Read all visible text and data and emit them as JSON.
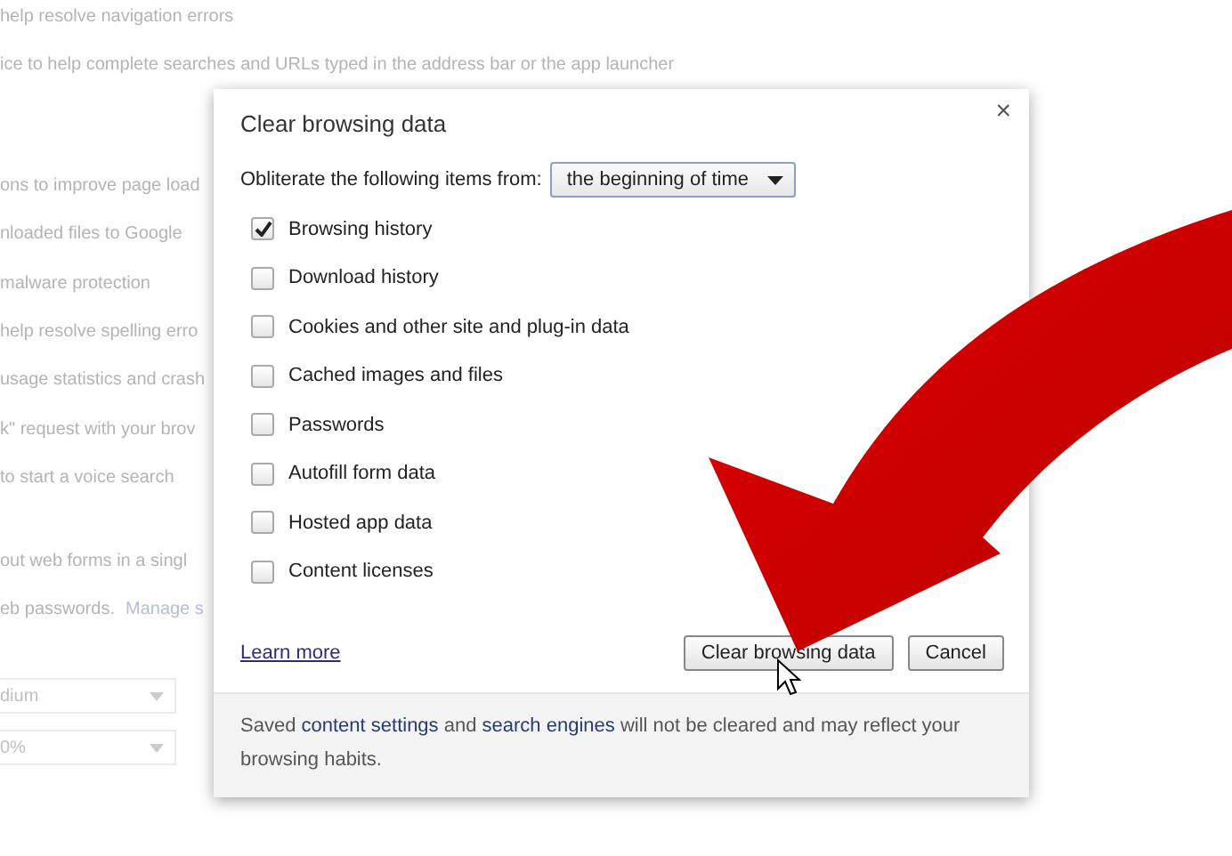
{
  "background": {
    "lines": [
      {
        "text": "help resolve navigation errors"
      },
      {
        "text": "ice to help complete searches and URLs typed in the address bar or the app launcher"
      },
      {
        "text": "ons to improve page load"
      },
      {
        "text": "nloaded files to Google"
      },
      {
        "text": "malware protection"
      },
      {
        "text": "help resolve spelling erro"
      },
      {
        "text": "usage statistics and crash"
      },
      {
        "text": "k\" request with your brov"
      },
      {
        "text": "to start a voice search"
      },
      {
        "text": "out web forms in a singl"
      },
      {
        "text": "eb passwords.",
        "link": "Manage s"
      }
    ],
    "selects": [
      "dium",
      "0%"
    ]
  },
  "dialog": {
    "title": "Clear browsing data",
    "close": "×",
    "from_label": "Obliterate the following items from:",
    "from_value": "the beginning of time",
    "items": [
      {
        "label": "Browsing history",
        "checked": true
      },
      {
        "label": "Download history",
        "checked": false
      },
      {
        "label": "Cookies and other site and plug-in data",
        "checked": false
      },
      {
        "label": "Cached images and files",
        "checked": false
      },
      {
        "label": "Passwords",
        "checked": false
      },
      {
        "label": "Autofill form data",
        "checked": false
      },
      {
        "label": "Hosted app data",
        "checked": false
      },
      {
        "label": "Content licenses",
        "checked": false
      }
    ],
    "learn_more": "Learn more",
    "buttons": [
      "Clear browsing data",
      "Cancel"
    ],
    "footer": [
      {
        "kind": "text",
        "text": "Saved "
      },
      {
        "kind": "link",
        "text": "content settings"
      },
      {
        "kind": "text",
        "text": " and "
      },
      {
        "kind": "link",
        "text": "search engines"
      },
      {
        "kind": "text",
        "text": " will not be cleared and may reflect your browsing habits."
      }
    ]
  }
}
